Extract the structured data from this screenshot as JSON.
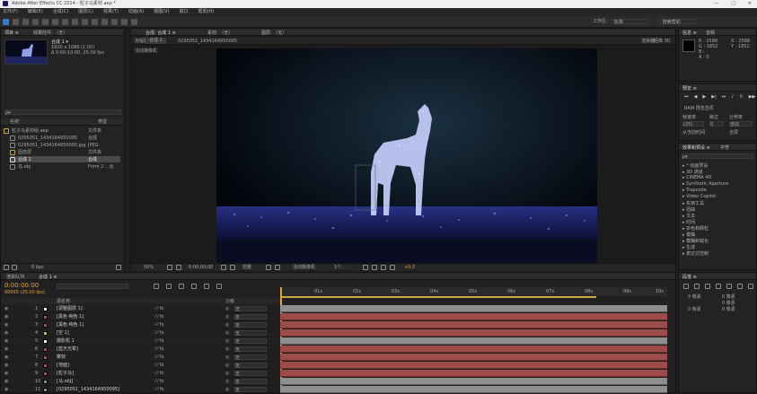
{
  "window": {
    "title": "Adobe After Effects CC 2014 - 粒子马素材.aep *",
    "controls": [
      "—",
      "□",
      "✕"
    ]
  },
  "menu": [
    "文件(F)",
    "编辑(E)",
    "合成(C)",
    "图层(L)",
    "效果(T)",
    "动画(A)",
    "视图(V)",
    "窗口",
    "帮助(H)"
  ],
  "toolbar": {
    "workspace_label": "工作区:",
    "workspace_value": "标准",
    "search_placeholder": "搜索帮助"
  },
  "project": {
    "tabs": [
      "项目 ≡",
      "效果控件: （无）"
    ],
    "comp_name": "合成 1 ▾",
    "comp_info": [
      "1920 x 1080 (1.00)",
      "Δ 0:00:10:00, 25.00 fps"
    ],
    "search_placeholder": "ρ▾",
    "col_name": "名称",
    "col_type": "类型",
    "items": [
      {
        "name": "粒子马素材组.aep",
        "type": "文件夹"
      },
      {
        "name": "0295051_1434164950095",
        "type": "合成"
      },
      {
        "name": "0295051_1434164950095.jpg",
        "type": "JPEG"
      },
      {
        "name": "固态层",
        "type": "文件夹"
      },
      {
        "name": "合成 1",
        "type": "合成"
      },
      {
        "name": "马.obj",
        "type": "Form 2 ...合"
      }
    ],
    "bpc": "8 bpc"
  },
  "viewer": {
    "tabs": [
      "合成: 合成 1 ≡",
      "素材: （无）",
      "图层: （无）"
    ],
    "flow_label": "流程图",
    "sub_tabs": [
      "合成 1",
      "0295051_1434164950095"
    ],
    "renderer_label": "渲染器:",
    "renderer_value": "经典 3D",
    "breadcrumb": "活动摄像机",
    "zoom": "50%",
    "timecode": "0:00:00:00",
    "resolution": "完整",
    "camera": "活动摄像机",
    "views": "1个...",
    "exposure": "+0.0"
  },
  "info": {
    "tabs": [
      "信息 ≡",
      "音频"
    ],
    "values": [
      "R : 2588",
      "G : 1852",
      "B :",
      "A : 0"
    ],
    "extra": [
      "X : 2588",
      "Y : 1852"
    ],
    "note": "摄像机 1"
  },
  "preview": {
    "tab": "预览 ≡",
    "ram_label": "RAM 预览选项",
    "frame_rate_label": "帧速率",
    "skip_label": "跳过",
    "resolution_label": "分辨率",
    "frame_rate": "(25)",
    "skip": "0",
    "resolution_value": "自动",
    "from_current": "从当前时间",
    "full_screen": "全屏"
  },
  "effects": {
    "tabs": [
      "效果和预设 ≡",
      "字符"
    ],
    "search_placeholder": "ρ▾",
    "categories": [
      "* 动画预设",
      "3D 通道",
      "CINEMA 4D",
      "Synthetic Aperture",
      "Trapcode",
      "Video Copilot",
      "实用工具",
      "扭曲",
      "文本",
      "时间",
      "杂色和颗粒",
      "模糊",
      "模糊和锐化",
      "生成",
      "表达式控制"
    ]
  },
  "timeline": {
    "tabs": [
      "渲染队列",
      "合成 1 ≡"
    ],
    "timecode": "0:00:00:00",
    "frame_info": "00000 (25.00 fps)",
    "col_source": "源名称",
    "col_parent": "父级",
    "ruler": [
      "01s",
      "02s",
      "03s",
      "04s",
      "05s",
      "06s",
      "07s",
      "08s",
      "09s",
      "10s"
    ],
    "layers": [
      {
        "num": "1",
        "name": "[调整图层 1]",
        "color": "#ffffff",
        "parent": "无",
        "bar": "gray"
      },
      {
        "num": "2",
        "name": "[黑色 纯色 1]",
        "color": "#b94a4a",
        "parent": "无",
        "bar": "red"
      },
      {
        "num": "3",
        "name": "[黑色 纯色 1]",
        "color": "#b94a4a",
        "parent": "无",
        "bar": "red"
      },
      {
        "num": "4",
        "name": "[空 1]",
        "color": "#d8b84a",
        "parent": "无",
        "bar": "red"
      },
      {
        "num": "5",
        "name": "摄影机 1",
        "color": "#ffffff",
        "parent": "无",
        "bar": "gray"
      },
      {
        "num": "6",
        "name": "[蓝天光晕]",
        "color": "#b94a4a",
        "parent": "无",
        "bar": "red"
      },
      {
        "num": "7",
        "name": "雾效",
        "color": "#b94a4a",
        "parent": "无",
        "bar": "red"
      },
      {
        "num": "8",
        "name": "[地面]",
        "color": "#b94a4a",
        "parent": "无",
        "bar": "red"
      },
      {
        "num": "9",
        "name": "[粒子马]",
        "color": "#b94a4a",
        "parent": "无",
        "bar": "red"
      },
      {
        "num": "10",
        "name": "[马.obj]",
        "color": "#8a8a8a",
        "parent": "无",
        "bar": "gray"
      },
      {
        "num": "11",
        "name": "[0295051_1434164950095]",
        "color": "#8a8a8a",
        "parent": "无",
        "bar": "gray"
      }
    ],
    "toggle_label": "切换开关/模式"
  },
  "paragraph": {
    "tabs": [
      "段落 ≡"
    ],
    "values": [
      "0 像素",
      "0 像素",
      "0 像素",
      "0 像素",
      "0 像素"
    ]
  }
}
